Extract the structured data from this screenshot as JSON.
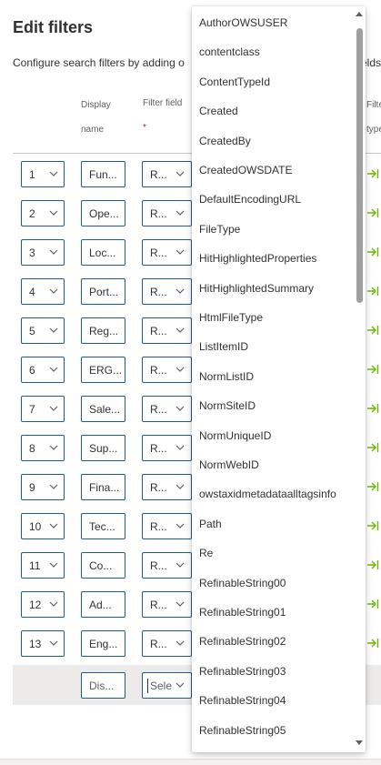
{
  "panel": {
    "title": "Edit filters",
    "description": "Configure search filters by adding o",
    "description_tail": "elds"
  },
  "table": {
    "headers": {
      "display_name_line1": "Display",
      "display_name_line2": "name",
      "filter_field": "Filter field",
      "required_mark": "*",
      "filter_type_line1": "Filte",
      "filter_type_line2": "type"
    },
    "rows": [
      {
        "num": "1",
        "name": "Fun...",
        "field": "R..."
      },
      {
        "num": "2",
        "name": "Ope...",
        "field": "R..."
      },
      {
        "num": "3",
        "name": "Loc...",
        "field": "R..."
      },
      {
        "num": "4",
        "name": "Port...",
        "field": "R..."
      },
      {
        "num": "5",
        "name": "Reg...",
        "field": "R..."
      },
      {
        "num": "6",
        "name": "ERG...",
        "field": "R..."
      },
      {
        "num": "7",
        "name": "Sale...",
        "field": "R..."
      },
      {
        "num": "8",
        "name": "Sup...",
        "field": "R..."
      },
      {
        "num": "9",
        "name": "Fina...",
        "field": "R..."
      },
      {
        "num": "10",
        "name": "Tec...",
        "field": "R..."
      },
      {
        "num": "11",
        "name": "Co...",
        "field": "R..."
      },
      {
        "num": "12",
        "name": "Ad...",
        "field": "R..."
      },
      {
        "num": "13",
        "name": "Eng...",
        "field": "R..."
      }
    ],
    "new_row": {
      "name_placeholder": "Dis...",
      "field_placeholder": "Sele"
    }
  },
  "dropdown": {
    "options": [
      "AuthorOWSUSER",
      "contentclass",
      "ContentTypeId",
      "Created",
      "CreatedBy",
      "CreatedOWSDATE",
      "DefaultEncodingURL",
      "FileType",
      "HitHighlightedProperties",
      "HitHighlightedSummary",
      "HtmlFileType",
      "ListItemID",
      "NormListID",
      "NormSiteID",
      "NormUniqueID",
      "NormWebID",
      "owstaxidmetadataalltagsinfo",
      "Path",
      "Re",
      "RefinableString00",
      "RefinableString01",
      "RefinableString02",
      "RefinableString03",
      "RefinableString04",
      "RefinableString05"
    ]
  },
  "icons": {
    "chevron": "chevron-down-icon",
    "filter_type": "arrow-right-to-bar-icon",
    "scroll_up": "scroll-up-icon",
    "scroll_down": "scroll-down-icon"
  },
  "colors": {
    "border_accent": "#1d5c91",
    "filter_type_icon": "#6bb700",
    "required": "#a4262c"
  }
}
